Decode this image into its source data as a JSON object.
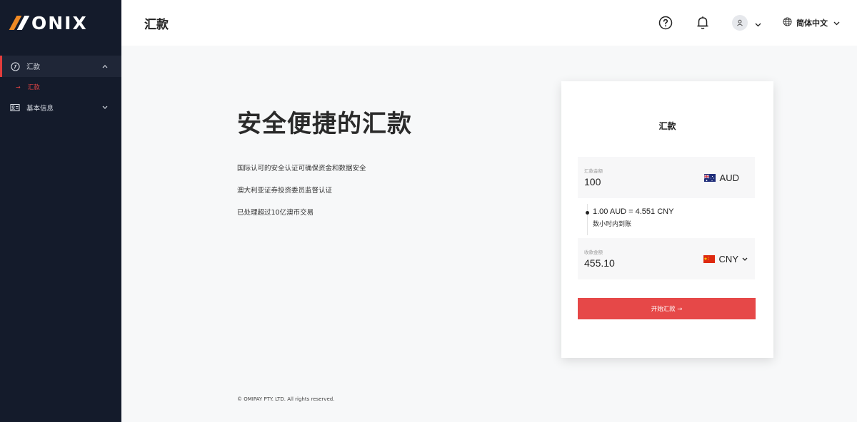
{
  "brand": {
    "logo_text": "ONIX",
    "accent": "#e23c3c"
  },
  "sidebar": {
    "items": [
      {
        "label": "汇款",
        "icon": "remit-icon",
        "expanded": true,
        "children": [
          {
            "label": "汇款",
            "active": true
          }
        ]
      },
      {
        "label": "基本信息",
        "icon": "id-card-icon",
        "expanded": false
      }
    ]
  },
  "header": {
    "title": "汇款",
    "language": "简体中文",
    "icons": [
      "help-icon",
      "bell-icon",
      "user-icon",
      "globe-icon"
    ]
  },
  "hero": {
    "title": "安全便捷的汇款",
    "features": [
      "国际认可的安全认证可确保资金和数据安全",
      "澳大利亚证券投资委员监督认证",
      "已处理超过10亿澳币交易"
    ]
  },
  "card": {
    "title": "汇款",
    "send": {
      "label": "汇款金额",
      "value": "100",
      "currency": "AUD"
    },
    "rate": {
      "text": "1.00 AUD = 4.551 CNY",
      "arrival": "数小时内到账"
    },
    "receive": {
      "label": "收款金额",
      "value": "455.10",
      "currency": "CNY"
    },
    "submit_label": "开始汇款 →"
  },
  "footer": {
    "copyright": "© OMIPAY PTY. LTD. All rights reserved."
  }
}
